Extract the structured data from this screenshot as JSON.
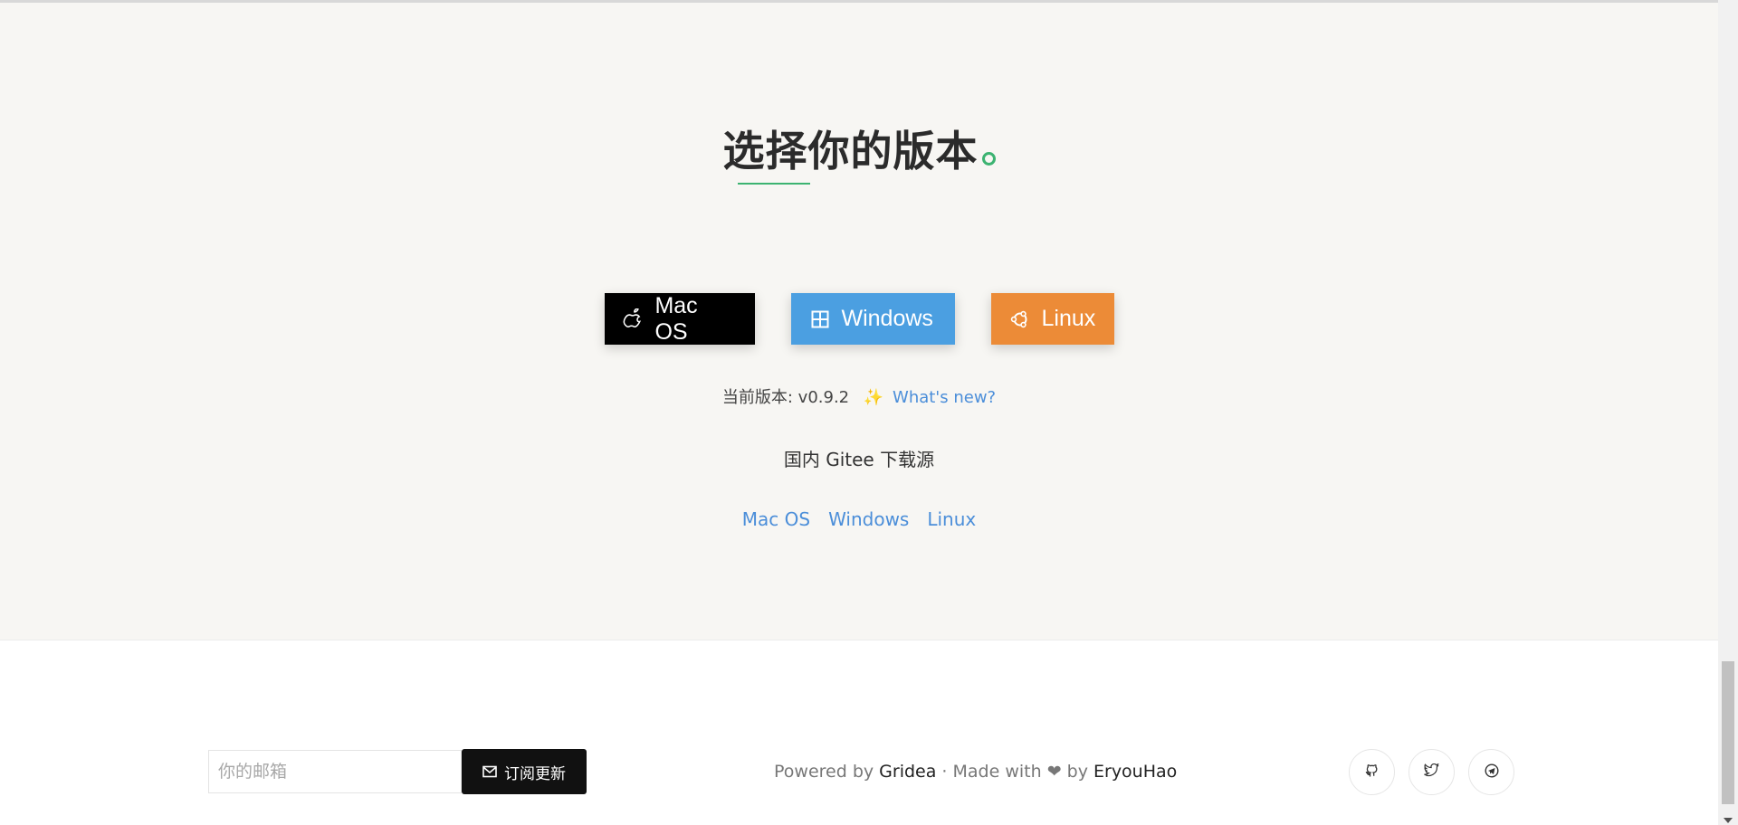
{
  "section": {
    "title": "选择你的版本",
    "title_dot": "。"
  },
  "buttons": {
    "mac": "Mac OS",
    "windows": "Windows",
    "linux": "Linux"
  },
  "version": {
    "label": "当前版本: v0.9.2",
    "sparkle": "✨",
    "whats_new": "What's new?"
  },
  "gitee": {
    "title": "国内 Gitee 下载源",
    "links": [
      "Mac OS",
      "Windows",
      "Linux"
    ]
  },
  "footer": {
    "email_placeholder": "你的邮箱",
    "subscribe_label": "订阅更新",
    "powered_prefix": "Powered by ",
    "powered_name": "Gridea",
    "made_with": " · Made with ",
    "heart": "❤",
    "by": " by ",
    "author": "EryouHao"
  },
  "social": [
    "github-icon",
    "twitter-icon",
    "telegram-icon"
  ],
  "colors": {
    "background": "#f7f6f3",
    "accent_green": "#3cb371",
    "mac_btn": "#000000",
    "windows_btn": "#4b9fe1",
    "linux_btn": "#ec8b37",
    "link": "#4b8ed9"
  }
}
